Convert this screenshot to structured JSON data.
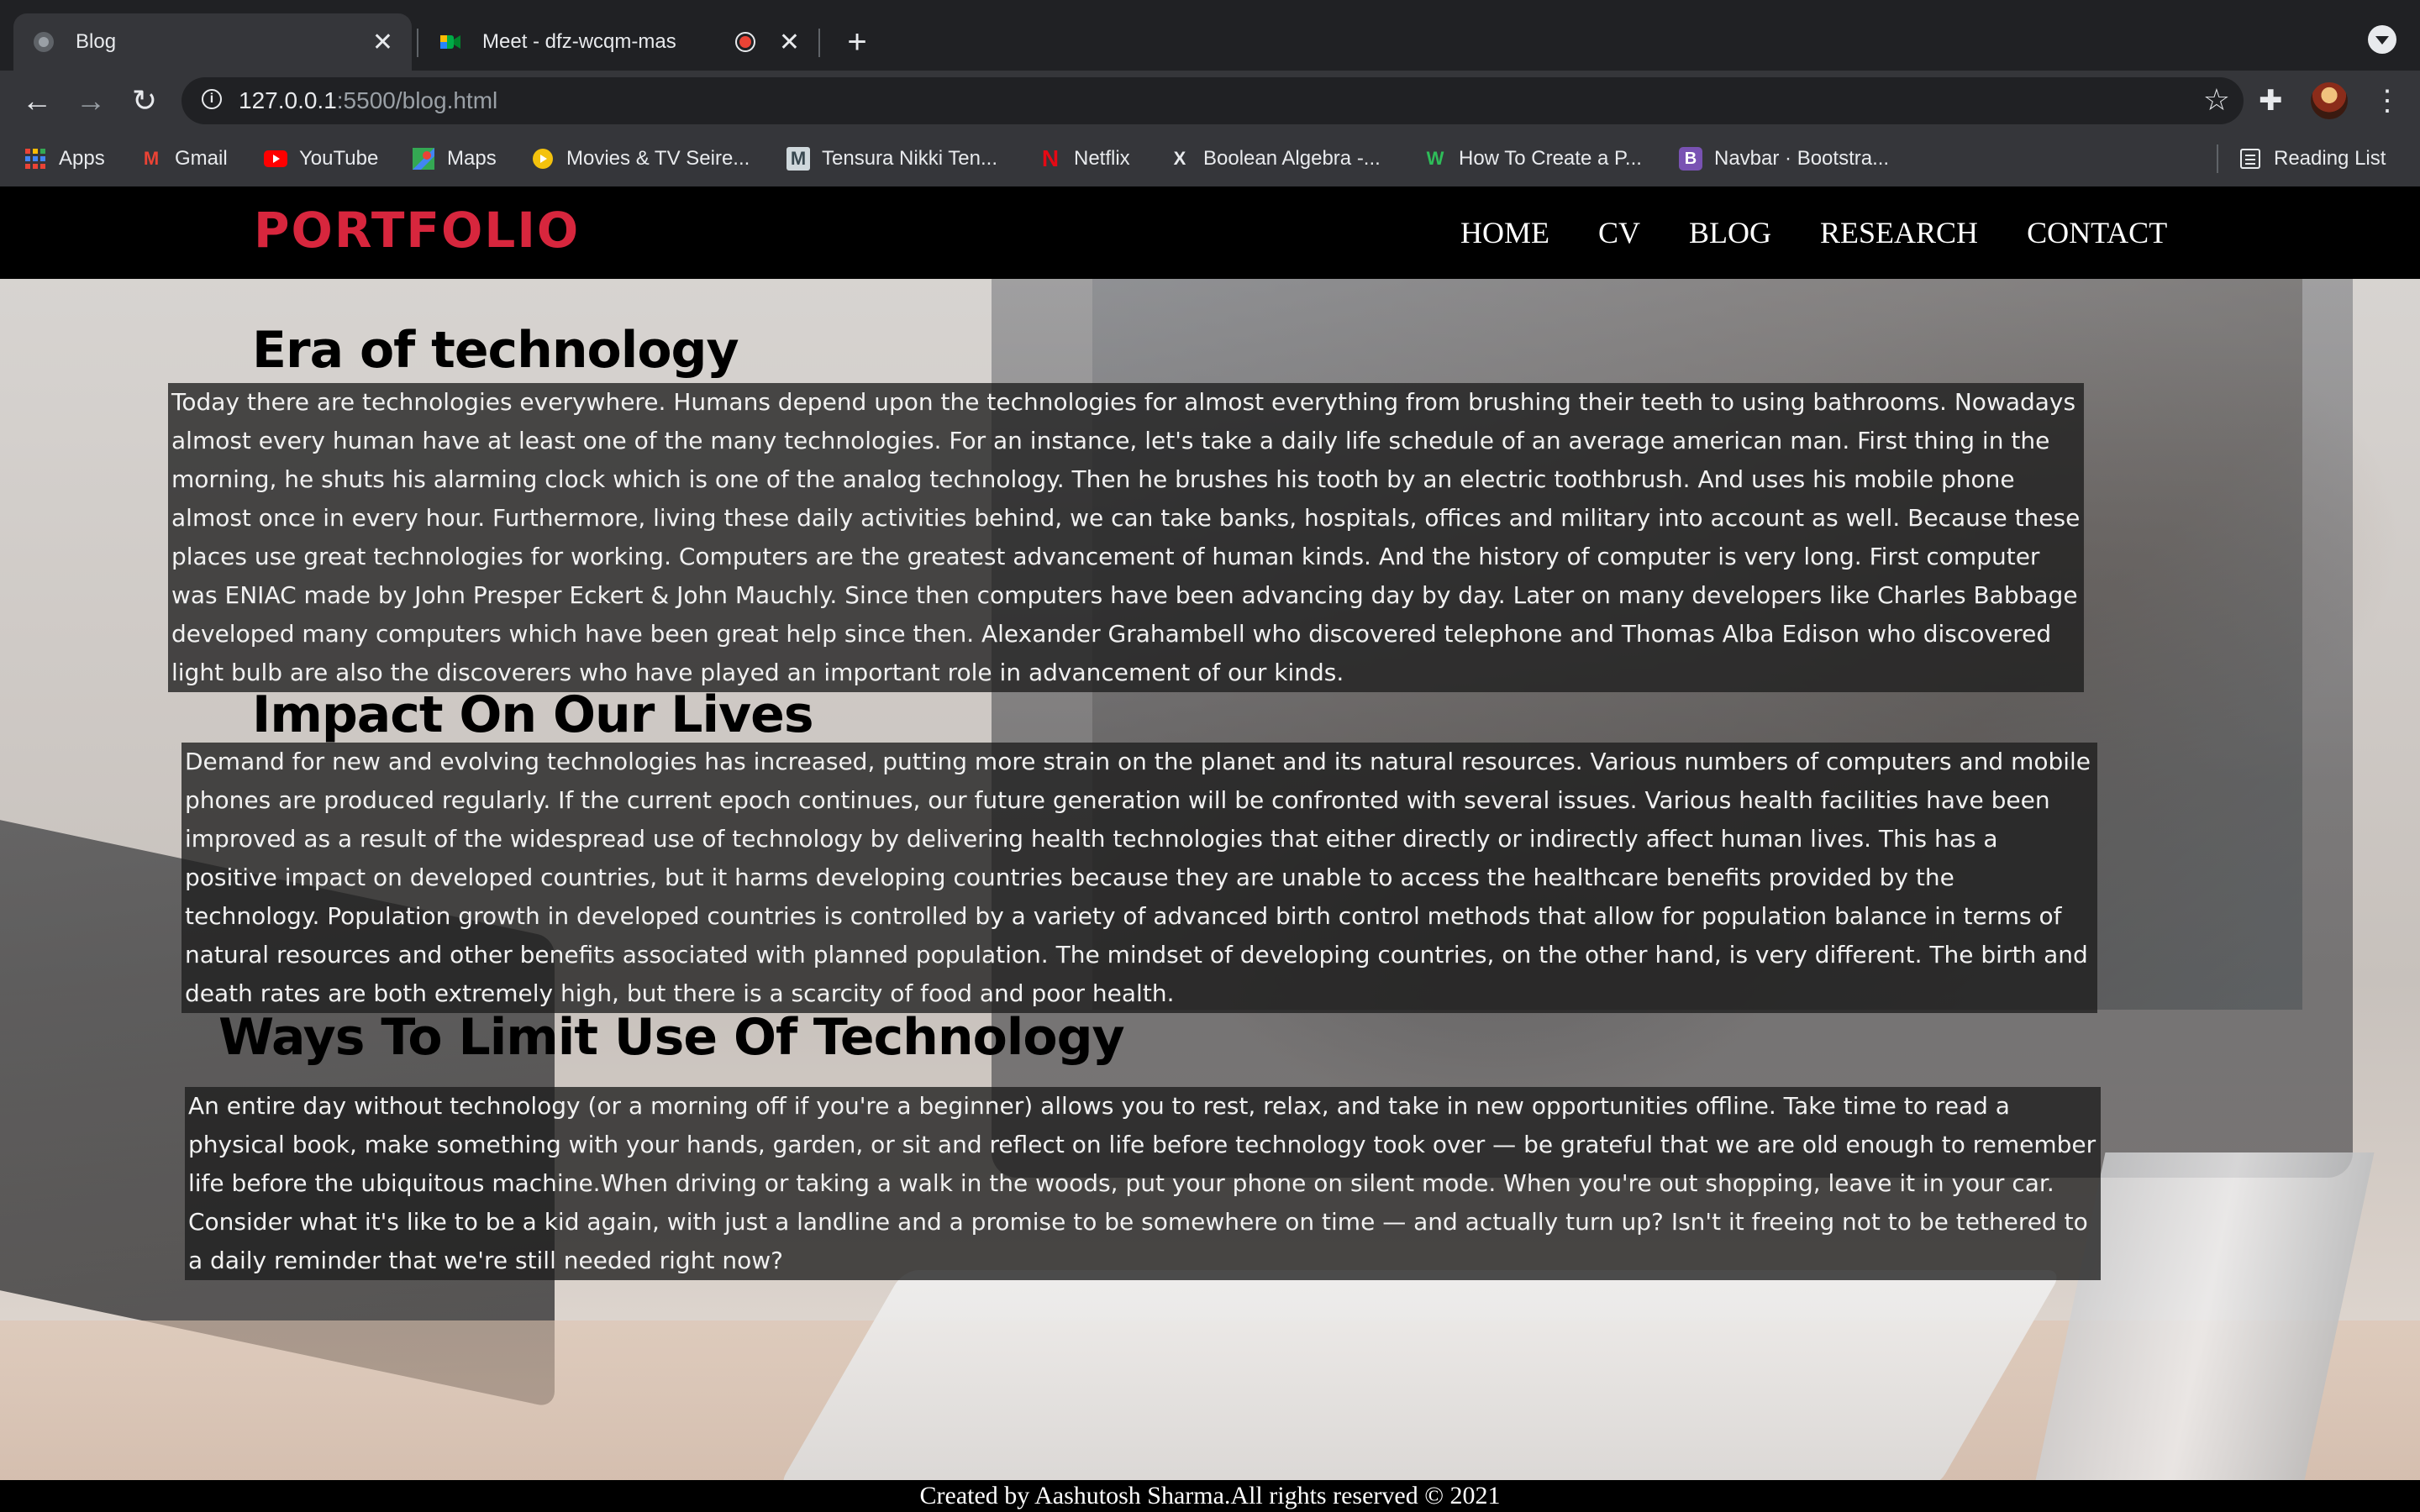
{
  "browser": {
    "tabs": [
      {
        "title": "Blog",
        "active": true
      },
      {
        "title": "Meet - dfz-wcqm-mas",
        "active": false
      }
    ],
    "url_host": "127.0.0.1",
    "url_rest": ":5500/blog.html",
    "bookmarks": [
      {
        "label": "Apps",
        "icon": "apps-grid-icon"
      },
      {
        "label": "Gmail",
        "icon": "gmail-icon"
      },
      {
        "label": "YouTube",
        "icon": "youtube-icon"
      },
      {
        "label": "Maps",
        "icon": "maps-icon"
      },
      {
        "label": "Movies & TV Seire...",
        "icon": "movies-icon"
      },
      {
        "label": "Tensura Nikki Ten...",
        "icon": "manga-icon"
      },
      {
        "label": "Netflix",
        "icon": "netflix-icon"
      },
      {
        "label": "Boolean Algebra -...",
        "icon": "boolean-icon"
      },
      {
        "label": "How To Create a P...",
        "icon": "wix-icon"
      },
      {
        "label": "Navbar · Bootstra...",
        "icon": "bootstrap-icon"
      }
    ],
    "reading_list": "Reading List"
  },
  "site": {
    "brand": "PORTFOLIO",
    "brand_color": "#d7263d",
    "nav": [
      "HOME",
      "CV",
      "BLOG",
      "RESEARCH",
      "CONTACT"
    ]
  },
  "sections": [
    {
      "heading": "Era of technology",
      "body": "Today there are technologies everywhere. Humans depend upon the technologies for almost everything from brushing their teeth to using bathrooms. Nowadays almost every human have at least one of the many technologies. For an instance, let's take a daily life schedule of an average american man. First thing in the morning, he shuts his alarming clock which is one of the analog technology. Then he brushes his tooth by an electric toothbrush. And uses his mobile phone almost once in every hour. Furthermore, living these daily activities behind, we can take banks, hospitals, offices and military into account as well. Because these places use great technologies for working. Computers are the greatest advancement of human kinds. And the history of computer is very long. First computer was ENIAC made by John Presper Eckert & John Mauchly. Since then computers have been advancing day by day. Later on many developers like Charles Babbage developed many computers which have been great help since then. Alexander Grahambell who discovered telephone and Thomas Alba Edison who discovered light bulb are also the discoverers who have played an important role in advancement of our kinds."
    },
    {
      "heading": "Impact On Our Lives",
      "body": "Demand for new and evolving technologies has increased, putting more strain on the planet and its natural resources. Various numbers of computers and mobile phones are produced regularly. If the current epoch continues, our future generation will be confronted with several issues. Various health facilities have been improved as a result of the widespread use of technology by delivering health technologies that either directly or indirectly affect human lives. This has a positive impact on developed countries, but it harms developing countries because they are unable to access the healthcare benefits provided by the technology. Population growth in developed countries is controlled by a variety of advanced birth control methods that allow for population balance in terms of natural resources and other benefits associated with planned population. The mindset of developing countries, on the other hand, is very different. The birth and death rates are both extremely high, but there is a scarcity of food and poor health."
    },
    {
      "heading": "Ways To Limit Use Of Technology",
      "body": "An entire day without technology (or a morning off if you're a beginner) allows you to rest, relax, and take in new opportunities offline. Take time to read a physical book, make something with your hands, garden, or sit and reflect on life before technology took over — be grateful that we are old enough to remember life before the ubiquitous machine.When driving or taking a walk in the woods, put your phone on silent mode. When you're out shopping, leave it in your car. Consider what it's like to be a kid again, with just a landline and a promise to be somewhere on time — and actually turn up? Isn't it freeing not to be tethered to a daily reminder that we're still needed right now?"
    }
  ],
  "footer": "Created by Aashutosh Sharma.All rights reserved © 2021"
}
